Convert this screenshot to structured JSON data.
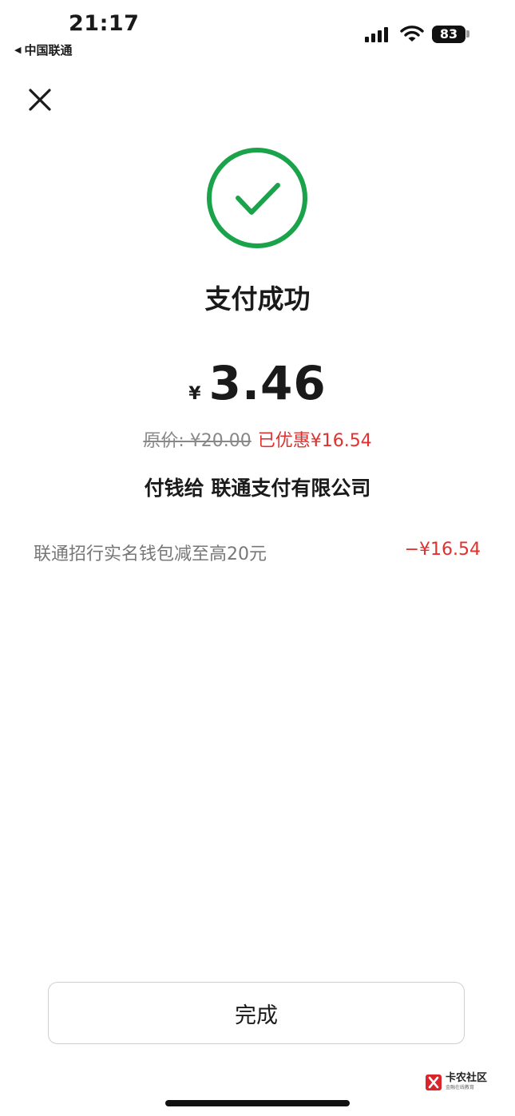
{
  "status_bar": {
    "time": "21:17",
    "carrier": "中国联通",
    "battery": "83"
  },
  "result": {
    "title": "支付成功",
    "currency": "¥",
    "amount": "3.46",
    "original_price": "原价: ¥20.00",
    "discount_text": "已优惠¥16.54",
    "payee": "付钱给  联通支付有限公司",
    "promo_label": "联通招行实名钱包减至高20元",
    "promo_amount": "−¥16.54"
  },
  "actions": {
    "done_label": "完成"
  },
  "watermark": {
    "main": "卡农社区",
    "sub": "金融在线教育"
  },
  "colors": {
    "success_green": "#1aa34a",
    "discount_red": "#e0312f"
  },
  "icons": [
    "back-triangle-icon",
    "signal-icon",
    "wifi-icon",
    "battery-icon",
    "close-icon",
    "check-circle-icon",
    "kanong-logo-icon"
  ]
}
